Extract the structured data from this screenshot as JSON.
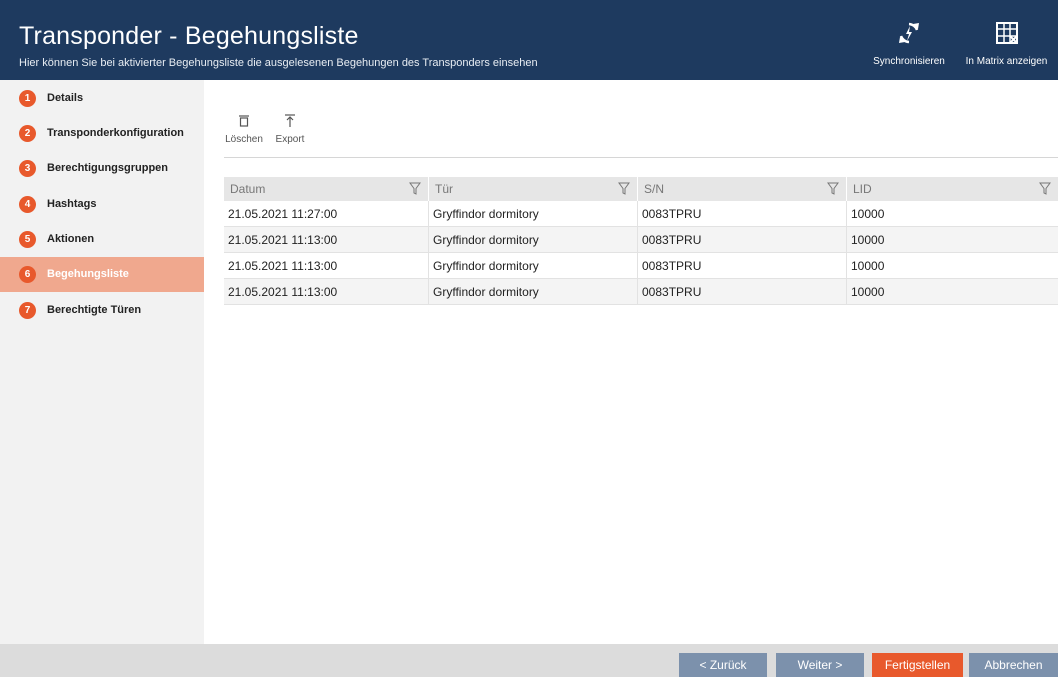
{
  "header": {
    "title": "Transponder - Begehungsliste",
    "subtitle": "Hier können Sie bei aktivierter Begehungsliste die ausgelesenen Begehungen des Transponders einsehen",
    "sync_label": "Synchronisieren",
    "matrix_label": "In Matrix anzeigen"
  },
  "sidebar": {
    "items": [
      {
        "num": "1",
        "label": "Details"
      },
      {
        "num": "2",
        "label": "Transponderkonfiguration"
      },
      {
        "num": "3",
        "label": "Berechtigungsgruppen"
      },
      {
        "num": "4",
        "label": "Hashtags"
      },
      {
        "num": "5",
        "label": "Aktionen"
      },
      {
        "num": "6",
        "label": "Begehungsliste"
      },
      {
        "num": "7",
        "label": "Berechtigte Türen"
      }
    ],
    "active_index": 5
  },
  "toolbar": {
    "delete_label": "Löschen",
    "export_label": "Export"
  },
  "table": {
    "columns": [
      "Datum",
      "Tür",
      "S/N",
      "LID"
    ],
    "rows": [
      [
        "21.05.2021 11:27:00",
        "Gryffindor dormitory",
        "0083TPRU",
        "10000"
      ],
      [
        "21.05.2021 11:13:00",
        "Gryffindor dormitory",
        "0083TPRU",
        "10000"
      ],
      [
        "21.05.2021 11:13:00",
        "Gryffindor dormitory",
        "0083TPRU",
        "10000"
      ],
      [
        "21.05.2021 11:13:00",
        "Gryffindor dormitory",
        "0083TPRU",
        "10000"
      ]
    ]
  },
  "footer": {
    "back_label": "< Zurück",
    "next_label": "Weiter >",
    "finish_label": "Fertigstellen",
    "cancel_label": "Abbrechen"
  },
  "colors": {
    "header_bg": "#1e3a5f",
    "accent": "#e8592c",
    "active_step": "#f0a88e",
    "nav_button": "#7c91ac"
  },
  "icons": {
    "sync": "sync-icon",
    "matrix": "matrix-icon",
    "delete": "trash-icon",
    "export": "export-icon",
    "filter": "filter-icon"
  }
}
